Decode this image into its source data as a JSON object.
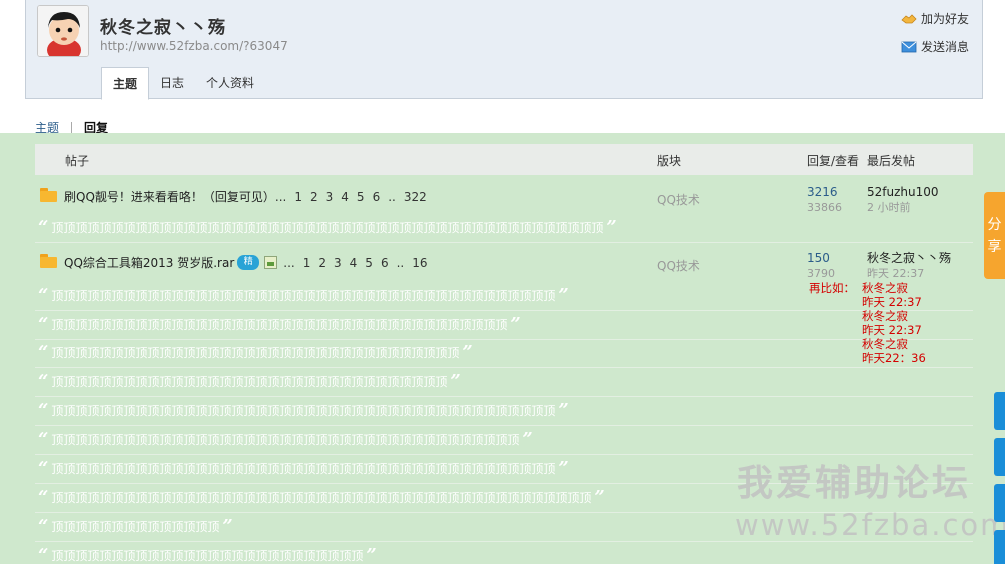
{
  "header": {
    "username": "秋冬之寂丶丶殇",
    "space_url": "http://www.52fzba.com/?63047",
    "actions": {
      "add_friend": "加为好友",
      "send_message": "发送消息"
    },
    "tabs": [
      {
        "label": "主题",
        "active": true
      },
      {
        "label": "日志",
        "active": false
      },
      {
        "label": "个人资料",
        "active": false
      }
    ]
  },
  "subtabs": {
    "topics": "主题",
    "replies": "回复"
  },
  "table": {
    "col_post": "帖子",
    "col_forum": "版块",
    "col_replies_views": "回复/查看",
    "col_last_post": "最后发帖"
  },
  "threads": [
    {
      "title": "刷QQ靓号！进来看看咯！（回复可见）",
      "ellipsis": "...",
      "pages": [
        "1",
        "2",
        "3",
        "4",
        "5",
        "6",
        "..",
        "322"
      ],
      "forum": "QQ技术",
      "replies": "3216",
      "views": "33866",
      "last_user": "52fuzhu100",
      "last_time": "2 小时前"
    },
    {
      "title": "QQ综合工具箱2013 贺岁版.rar",
      "badge": "精",
      "ellipsis": "...",
      "pages": [
        "1",
        "2",
        "3",
        "4",
        "5",
        "6",
        "..",
        "16"
      ],
      "forum": "QQ技术",
      "replies": "150",
      "views": "3790",
      "last_user": "秋冬之寂丶丶殇",
      "last_time": "昨天 22:37"
    }
  ],
  "reply_first": "顶顶顶顶顶顶顶顶顶顶顶顶顶顶顶顶顶顶顶顶顶顶顶顶顶顶顶顶顶顶顶顶顶顶顶顶顶顶顶顶顶顶顶顶顶顶",
  "replies": [
    "顶顶顶顶顶顶顶顶顶顶顶顶顶顶顶顶顶顶顶顶顶顶顶顶顶顶顶顶顶顶顶顶顶顶顶顶顶顶顶顶顶顶",
    "顶顶顶顶顶顶顶顶顶顶顶顶顶顶顶顶顶顶顶顶顶顶顶顶顶顶顶顶顶顶顶顶顶顶顶顶顶顶",
    "顶顶顶顶顶顶顶顶顶顶顶顶顶顶顶顶顶顶顶顶顶顶顶顶顶顶顶顶顶顶顶顶顶顶",
    "顶顶顶顶顶顶顶顶顶顶顶顶顶顶顶顶顶顶顶顶顶顶顶顶顶顶顶顶顶顶顶顶顶",
    "顶顶顶顶顶顶顶顶顶顶顶顶顶顶顶顶顶顶顶顶顶顶顶顶顶顶顶顶顶顶顶顶顶顶顶顶顶顶顶顶顶顶",
    "顶顶顶顶顶顶顶顶顶顶顶顶顶顶顶顶顶顶顶顶顶顶顶顶顶顶顶顶顶顶顶顶顶顶顶顶顶顶顶",
    "顶顶顶顶顶顶顶顶顶顶顶顶顶顶顶顶顶顶顶顶顶顶顶顶顶顶顶顶顶顶顶顶顶顶顶顶顶顶顶顶顶顶",
    "顶顶顶顶顶顶顶顶顶顶顶顶顶顶顶顶顶顶顶顶顶顶顶顶顶顶顶顶顶顶顶顶顶顶顶顶顶顶顶顶顶顶顶顶顶",
    "顶顶顶顶顶顶顶顶顶顶顶顶顶顶",
    "顶顶顶顶顶顶顶顶顶顶顶顶顶顶顶顶顶顶顶顶顶顶顶顶顶顶"
  ],
  "annotation": {
    "label": "再比如：",
    "lines": [
      "秋冬之寂",
      "昨天 22:37",
      "秋冬之寂",
      " 昨天 22:37",
      "秋冬之寂",
      "昨天22：36"
    ]
  },
  "watermark": {
    "line1": "我爱辅助论坛",
    "line2": "www.52fzba.com"
  },
  "share": "分享",
  "colors": {
    "accent": "#2b5c8a",
    "overlay_green": "#cfe8cd",
    "annotation_red": "#d40000",
    "share_orange": "#f6a52e"
  }
}
